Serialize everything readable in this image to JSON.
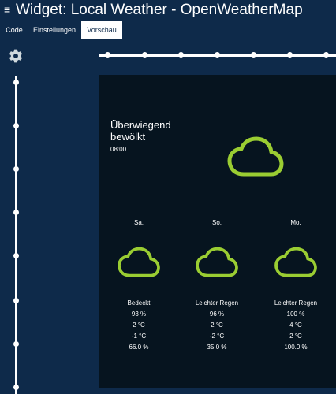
{
  "header": {
    "title": "Widget: Local Weather - OpenWeatherMap",
    "menu_icon": "menu-icon"
  },
  "tabs": [
    {
      "label": "Code",
      "active": false
    },
    {
      "label": "Einstellungen",
      "active": false
    },
    {
      "label": "Vorschau",
      "active": true
    }
  ],
  "settings_icon": "gear-icon",
  "colors": {
    "background": "#0e2a4a",
    "panel": "#06141f",
    "cloud": "#9acd32"
  },
  "weather": {
    "current": {
      "description": "Überwiegend bewölkt",
      "time": "08:00",
      "icon": "cloud-icon"
    },
    "forecast": [
      {
        "day": "Sa.",
        "description": "Bedeckt",
        "humidity": "93 %",
        "temp_max": "2 °C",
        "temp_min": "-1 °C",
        "rain_prob": "66.0 %",
        "icon": "cloud-icon"
      },
      {
        "day": "So.",
        "description": "Leichter Regen",
        "humidity": "96 %",
        "temp_max": "2 °C",
        "temp_min": "-2 °C",
        "rain_prob": "35.0 %",
        "icon": "cloud-icon"
      },
      {
        "day": "Mo.",
        "description": "Leichter Regen",
        "humidity": "100 %",
        "temp_max": "4 °C",
        "temp_min": "2 °C",
        "rain_prob": "100.0 %",
        "icon": "cloud-icon"
      }
    ]
  }
}
